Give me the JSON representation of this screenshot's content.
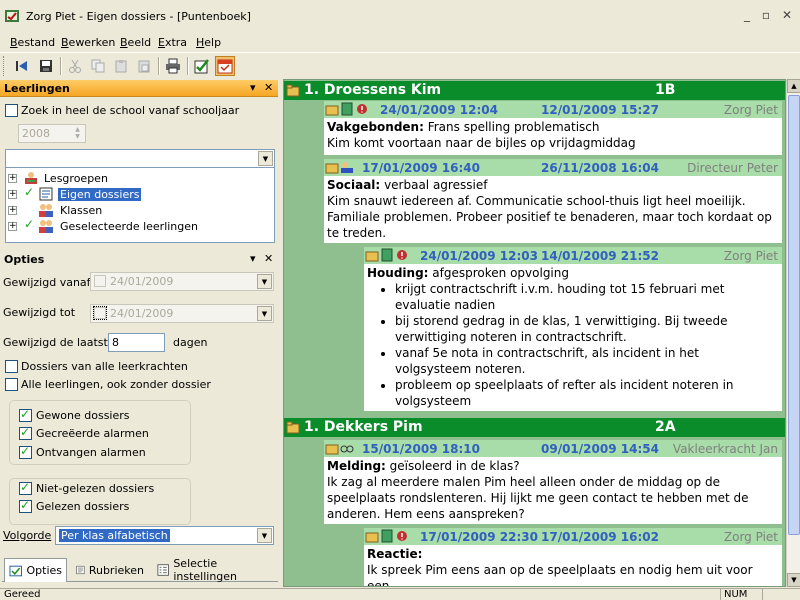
{
  "window": {
    "title": "Zorg Piet - Eigen dossiers - [Puntenboek]",
    "controls": [
      "minimize-icon",
      "restore-icon",
      "close-icon"
    ]
  },
  "menu": [
    "Bestand",
    "Bewerken",
    "Beeld",
    "Extra",
    "Help"
  ],
  "toolbar": {
    "buttons": [
      "first-icon",
      "save-icon",
      "cut-icon",
      "copy-icon",
      "paste-icon",
      "paste-special-icon",
      "print-icon",
      "check-icon",
      "calendar-icon"
    ]
  },
  "leerlingen": {
    "title": "Leerlingen",
    "search_label": "Zoek in heel de school vanaf schooljaar",
    "year": "2008",
    "dropdown_value": "",
    "tree": [
      {
        "label": "Lesgroepen",
        "checked": false,
        "selected": false,
        "icon": "group-icon"
      },
      {
        "label": "Eigen dossiers",
        "checked": true,
        "selected": true,
        "icon": "dossier-icon"
      },
      {
        "label": "Klassen",
        "checked": false,
        "selected": false,
        "icon": "class-icon"
      },
      {
        "label": "Geselecteerde leerlingen",
        "checked": true,
        "selected": false,
        "icon": "students-icon"
      }
    ]
  },
  "opties": {
    "title": "Opties",
    "gewijzigd_vanaf_label": "Gewijzigd vanaf",
    "gewijzigd_vanaf_value": "24/01/2009",
    "gewijzigd_tot_label": "Gewijzigd tot",
    "gewijzigd_tot_value": "24/01/2009",
    "laatste_label": "Gewijzigd de laatste",
    "laatste_value": "8",
    "dagen_label": "dagen",
    "alle_leerkrachten": "Dossiers van alle leerkrachten",
    "alle_leerlingen": "Alle leerlingen, ook zonder dossier",
    "group1": [
      {
        "label": "Gewone dossiers",
        "checked": true
      },
      {
        "label": "Gecreëerde alarmen",
        "checked": true
      },
      {
        "label": "Ontvangen alarmen",
        "checked": true
      }
    ],
    "group2": [
      {
        "label": "Niet-gelezen dossiers",
        "checked": true
      },
      {
        "label": "Gelezen dossiers",
        "checked": true
      }
    ],
    "volgorde_label": "Volgorde",
    "volgorde_value": "Per klas alfabetisch"
  },
  "tabs": [
    {
      "label": "Opties",
      "active": true
    },
    {
      "label": "Rubrieken",
      "active": false
    },
    {
      "label": "Selectie instellingen",
      "active": false
    }
  ],
  "students": [
    {
      "name": "1. Droessens Kim",
      "class": "1B",
      "entries": [
        {
          "date1": "24/01/2009 12:04",
          "date2": "12/01/2009 15:27",
          "author": "Zorg Piet",
          "category": "Vakgebonden:",
          "subject": "Frans spelling problematisch",
          "text": "Kim komt voortaan naar de bijles op vrijdagmiddag"
        },
        {
          "date1": "17/01/2009 16:40",
          "date2": "26/11/2008 16:04",
          "author": "Directeur Peter",
          "category": "Sociaal:",
          "subject": "verbaal agressief",
          "text": "Kim snauwt iedereen af. Communicatie school-thuis ligt heel moeilijk. Familiale problemen. Probeer positief te benaderen, maar toch kordaat op te treden."
        },
        {
          "date1": "24/01/2009 12:03",
          "date2": "14/01/2009 21:52",
          "author": "Zorg Piet",
          "category": "Houding:",
          "subject": "afgesproken opvolging",
          "bullets": [
            "krijgt contractschrift i.v.m. houding tot 15 februari met evaluatie nadien",
            "bij storend gedrag in de klas, 1 verwittiging. Bij tweede verwittiging noteren in contractschrift.",
            "vanaf 5e nota in contractschrift, als incident in het volgsysteem noteren.",
            "probleem op speelplaats of refter als incident noteren in volgsysteem"
          ]
        }
      ]
    },
    {
      "name": "1. Dekkers Pim",
      "class": "2A",
      "entries": [
        {
          "date1": "15/01/2009 18:10",
          "date2": "09/01/2009 14:54",
          "author": "Vakleerkracht Jan",
          "category": "Melding:",
          "subject": "geïsoleerd in de klas?",
          "text": "Ik zag al meerdere malen Pim heel alleen onder de middag op de speelplaats rondslenteren. Hij lijkt me geen contact te hebben met de anderen. Hem eens aanspreken?"
        },
        {
          "date1": "17/01/2009 22:30",
          "date2": "17/01/2009 16:02",
          "author": "Zorg Piet",
          "category": "Reactie:",
          "subject": "",
          "text": "Ik spreek Pim eens aan op de speelplaats en nodig hem uit voor een"
        }
      ]
    }
  ],
  "status": {
    "left": "Gereed",
    "num": "NUM"
  }
}
